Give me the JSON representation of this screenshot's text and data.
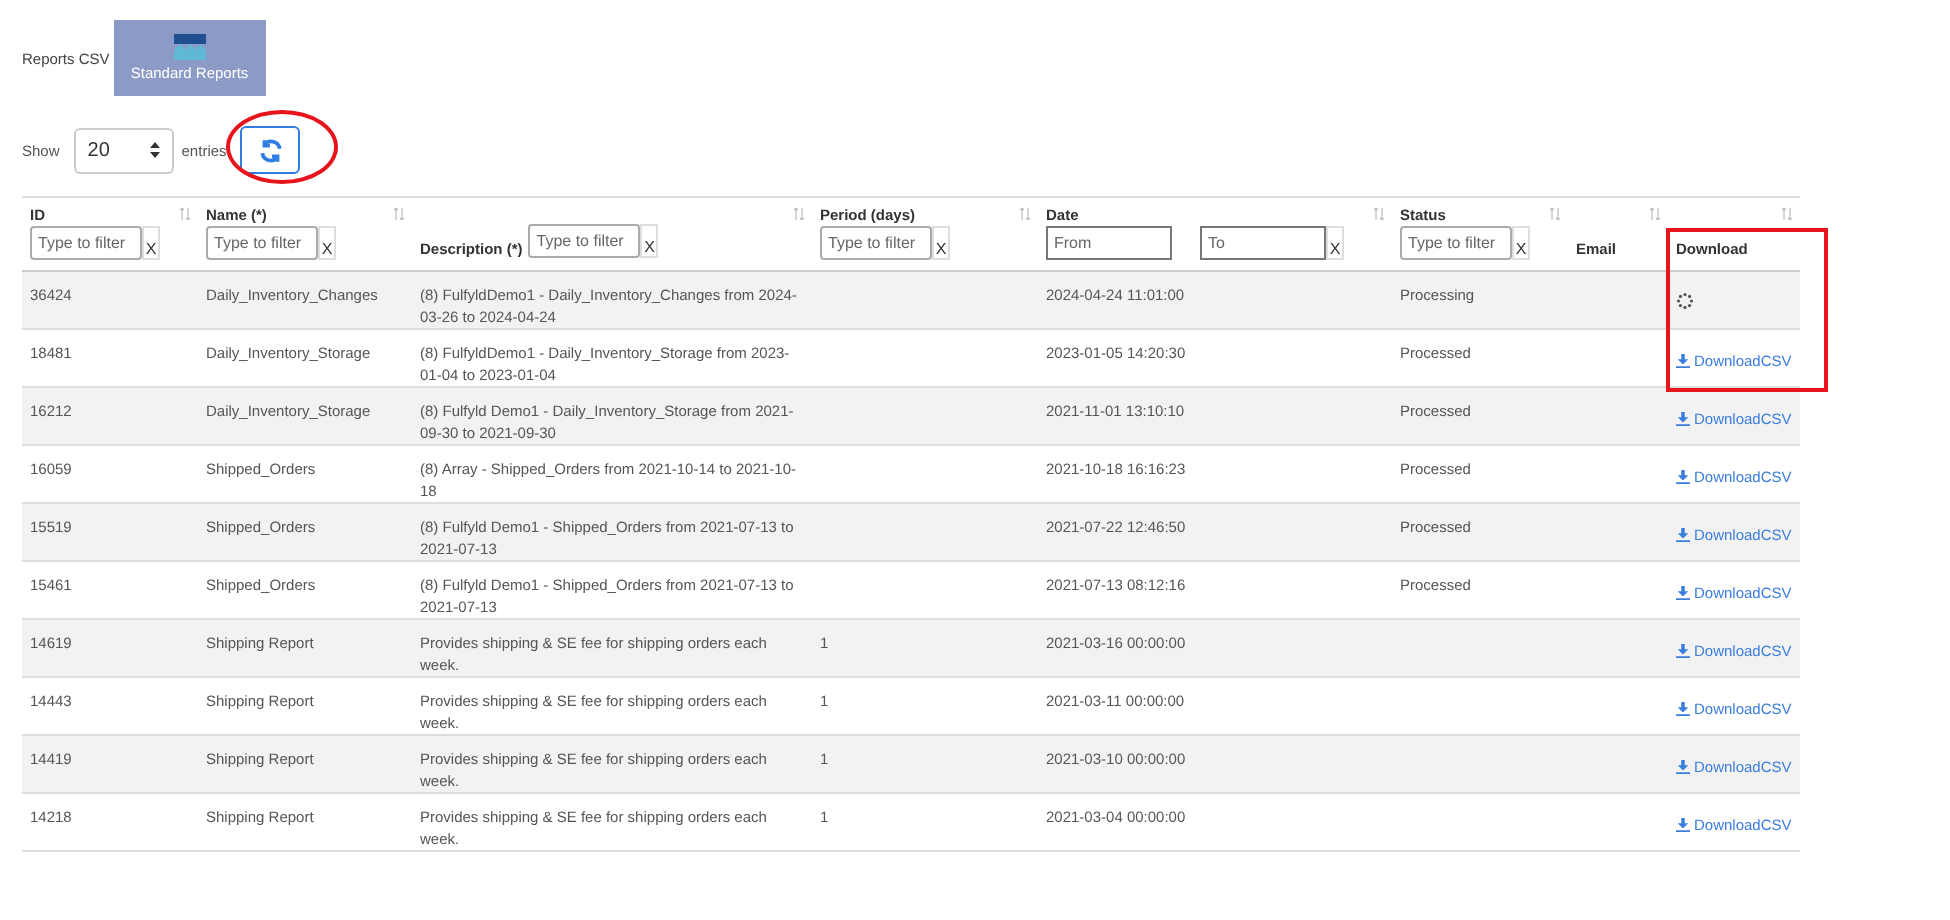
{
  "page_title": "Reports CSV",
  "nav_tile": {
    "label": "Standard Reports"
  },
  "length_control": {
    "before": "Show",
    "value": "20",
    "after": "entries"
  },
  "columns": [
    {
      "label": "ID",
      "kind": "stacked",
      "filter_fields": [
        {
          "placeholder": "Type to filter"
        }
      ],
      "clear": "X"
    },
    {
      "label": "Name (*)",
      "kind": "stacked",
      "filter_fields": [
        {
          "placeholder": "Type to filter"
        }
      ],
      "clear": "X"
    },
    {
      "label": "Description (*)",
      "kind": "inline",
      "filter_fields": [
        {
          "placeholder": "Type to filter"
        }
      ],
      "clear": "X"
    },
    {
      "label": "Period (days)",
      "kind": "stacked",
      "filter_fields": [
        {
          "placeholder": "Type to filter"
        }
      ],
      "clear": "X"
    },
    {
      "label": "Date",
      "kind": "stacked",
      "filter_fields": [
        {
          "placeholder": "From"
        },
        {
          "placeholder": "To"
        }
      ],
      "clear": "X"
    },
    {
      "label": "Status",
      "kind": "stacked",
      "filter_fields": [
        {
          "placeholder": "Type to filter"
        }
      ],
      "clear": "X"
    },
    {
      "label": "Email",
      "kind": "plain"
    },
    {
      "label": "Download",
      "kind": "plain"
    }
  ],
  "rows": [
    {
      "id": "36424",
      "name": "Daily_Inventory_Changes",
      "description": "(8) FulfyldDemo1 - Daily_Inventory_Changes from 2024-03-26 to 2024-04-24",
      "date": "2024-04-24 11:01:00",
      "status": "Processing",
      "download": {
        "kind": "spinner"
      }
    },
    {
      "id": "18481",
      "name": "Daily_Inventory_Storage",
      "description": "(8) FulfyldDemo1 - Daily_Inventory_Storage from 2023-01-04 to 2023-01-04",
      "date": "2023-01-05 14:20:30",
      "status": "Processed",
      "download": {
        "kind": "link",
        "label": "DownloadCSV"
      }
    },
    {
      "id": "16212",
      "name": "Daily_Inventory_Storage",
      "description": "(8) Fulfyld Demo1 - Daily_Inventory_Storage from 2021-09-30 to 2021-09-30",
      "date": "2021-11-01 13:10:10",
      "status": "Processed",
      "download": {
        "kind": "link",
        "label": "DownloadCSV"
      }
    },
    {
      "id": "16059",
      "name": "Shipped_Orders",
      "description": "(8) Array - Shipped_Orders from 2021-10-14 to 2021-10-18",
      "date": "2021-10-18 16:16:23",
      "status": "Processed",
      "download": {
        "kind": "link",
        "label": "DownloadCSV"
      }
    },
    {
      "id": "15519",
      "name": "Shipped_Orders",
      "description": "(8) Fulfyld Demo1 - Shipped_Orders from 2021-07-13 to 2021-07-13",
      "date": "2021-07-22 12:46:50",
      "status": "Processed",
      "download": {
        "kind": "link",
        "label": "DownloadCSV"
      }
    },
    {
      "id": "15461",
      "name": "Shipped_Orders",
      "description": "(8) Fulfyld Demo1 - Shipped_Orders from 2021-07-13 to 2021-07-13",
      "date": "2021-07-13 08:12:16",
      "status": "Processed",
      "download": {
        "kind": "link",
        "label": "DownloadCSV"
      }
    },
    {
      "id": "14619",
      "name": "Shipping Report",
      "description": "Provides shipping & SE fee for shipping orders each week.",
      "period": "1",
      "date": "2021-03-16 00:00:00",
      "download": {
        "kind": "link",
        "label": "DownloadCSV"
      }
    },
    {
      "id": "14443",
      "name": "Shipping Report",
      "description": "Provides shipping & SE fee for shipping orders each week.",
      "period": "1",
      "date": "2021-03-11 00:00:00",
      "download": {
        "kind": "link",
        "label": "DownloadCSV"
      }
    },
    {
      "id": "14419",
      "name": "Shipping Report",
      "description": "Provides shipping & SE fee for shipping orders each week.",
      "period": "1",
      "date": "2021-03-10 00:00:00",
      "download": {
        "kind": "link",
        "label": "DownloadCSV"
      }
    },
    {
      "id": "14218",
      "name": "Shipping Report",
      "description": "Provides shipping & SE fee for shipping orders each week.",
      "period": "1",
      "date": "2021-03-04 00:00:00",
      "download": {
        "kind": "link",
        "label": "DownloadCSV"
      }
    }
  ],
  "annotations": [
    {
      "kind": "ellipse",
      "color": "#e8141b"
    },
    {
      "kind": "rectangle",
      "color": "#e8141b"
    }
  ]
}
